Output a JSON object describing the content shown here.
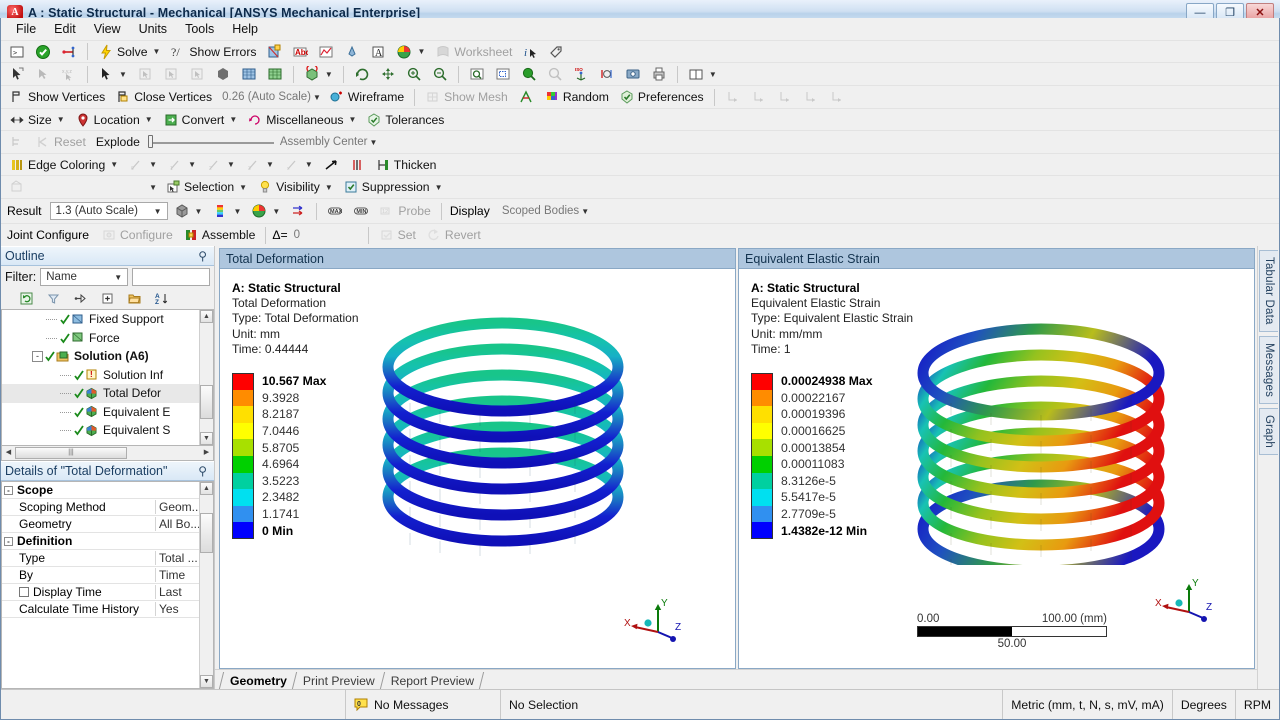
{
  "window": {
    "title": "A : Static Structural - Mechanical [ANSYS Mechanical Enterprise]",
    "app_icon": "ansys-logo-icon",
    "minimize_label": "—",
    "maximize_label": "❐",
    "close_label": "✕"
  },
  "menubar": {
    "items": [
      {
        "label": "File"
      },
      {
        "label": "Edit"
      },
      {
        "label": "View"
      },
      {
        "label": "Units"
      },
      {
        "label": "Tools"
      },
      {
        "label": "Help"
      }
    ]
  },
  "toolbar_main": {
    "solve_label": "Solve",
    "show_errors_label": "Show Errors",
    "worksheet_label": "Worksheet"
  },
  "toolbar_graphics": {
    "show_vertices_label": "Show Vertices",
    "close_vertices_label": "Close Vertices",
    "auto_scale_value": "0.26 (Auto Scale)",
    "wireframe_label": "Wireframe",
    "show_mesh_label": "Show Mesh",
    "random_label": "Random",
    "preferences_label": "Preferences"
  },
  "toolbar_edit": {
    "size_label": "Size",
    "location_label": "Location",
    "convert_label": "Convert",
    "miscellaneous_label": "Miscellaneous",
    "tolerances_label": "Tolerances"
  },
  "toolbar_explode": {
    "reset_label": "Reset",
    "explode_label": "Explode",
    "assembly_center_label": "Assembly Center"
  },
  "toolbar_edge": {
    "edge_coloring_label": "Edge Coloring",
    "thicken_label": "Thicken"
  },
  "toolbar_selection": {
    "selection_label": "Selection",
    "visibility_label": "Visibility",
    "suppression_label": "Suppression"
  },
  "toolbar_result": {
    "result_label": "Result",
    "result_scale_value": "1.3 (Auto Scale)",
    "probe_label": "Probe",
    "display_label": "Display",
    "display_value": "Scoped Bodies"
  },
  "toolbar_joint": {
    "joint_configure_label": "Joint Configure",
    "configure_label": "Configure",
    "assemble_label": "Assemble",
    "delta_label": "Δ=",
    "delta_value": "0",
    "set_label": "Set",
    "revert_label": "Revert"
  },
  "outline": {
    "panel_title": "Outline",
    "filter_label": "Filter:",
    "filter_value": "Name",
    "filter_text": "",
    "tree": [
      {
        "label": "Fixed Support",
        "indent": 3,
        "bold": false,
        "expander": "",
        "selected": false
      },
      {
        "label": "Force",
        "indent": 3,
        "bold": false,
        "expander": "",
        "selected": false
      },
      {
        "label": "Solution (A6)",
        "indent": 2,
        "bold": true,
        "expander": "-",
        "selected": false
      },
      {
        "label": "Solution Inf",
        "indent": 4,
        "bold": false,
        "expander": "",
        "selected": false
      },
      {
        "label": "Total Defor",
        "indent": 4,
        "bold": false,
        "expander": "",
        "selected": true
      },
      {
        "label": "Equivalent E",
        "indent": 4,
        "bold": false,
        "expander": "",
        "selected": false
      },
      {
        "label": "Equivalent S",
        "indent": 4,
        "bold": false,
        "expander": "",
        "selected": false
      }
    ]
  },
  "details": {
    "panel_title": "Details of \"Total Deformation\"",
    "rows": [
      {
        "kind": "header",
        "name": "Scope",
        "value": "",
        "expander": "-"
      },
      {
        "kind": "row",
        "name": "Scoping Method",
        "value": "Geom...",
        "checkbox": false
      },
      {
        "kind": "row",
        "name": "Geometry",
        "value": "All Bo...",
        "checkbox": false
      },
      {
        "kind": "header",
        "name": "Definition",
        "value": "",
        "expander": "-"
      },
      {
        "kind": "row",
        "name": "Type",
        "value": "Total ...",
        "checkbox": false
      },
      {
        "kind": "row",
        "name": "By",
        "value": "Time",
        "checkbox": false
      },
      {
        "kind": "row",
        "name": "Display Time",
        "value": "Last",
        "checkbox": true
      },
      {
        "kind": "row",
        "name": "Calculate Time History",
        "value": "Yes",
        "checkbox": false
      }
    ]
  },
  "viewport_left": {
    "title": "Total Deformation",
    "annotation": {
      "line1": "A: Static Structural",
      "line2": "Total Deformation",
      "line3": "Type: Total Deformation",
      "line4": "Unit: mm",
      "line5": "Time: 0.44444"
    },
    "legend": [
      {
        "label": "10.567 Max",
        "color": "#ff0000",
        "bold": true
      },
      {
        "label": "9.3928",
        "color": "#ff8c00",
        "bold": false
      },
      {
        "label": "8.2187",
        "color": "#ffe000",
        "bold": false
      },
      {
        "label": "7.0446",
        "color": "#ffff00",
        "bold": false
      },
      {
        "label": "5.8705",
        "color": "#a8e000",
        "bold": false
      },
      {
        "label": "4.6964",
        "color": "#00d000",
        "bold": false
      },
      {
        "label": "3.5223",
        "color": "#00d0a0",
        "bold": false
      },
      {
        "label": "2.3482",
        "color": "#00e0f0",
        "bold": false
      },
      {
        "label": "1.1741",
        "color": "#3090f0",
        "bold": false
      },
      {
        "label": "0 Min",
        "color": "#0000ff",
        "bold": true
      }
    ],
    "triad": {
      "x_label": "X",
      "y_label": "Y",
      "z_label": "Z"
    }
  },
  "viewport_right": {
    "title": "Equivalent Elastic Strain",
    "annotation": {
      "line1": "A: Static Structural",
      "line2": "Equivalent Elastic Strain",
      "line3": "Type: Equivalent Elastic Strain",
      "line4": "Unit: mm/mm",
      "line5": "Time: 1"
    },
    "legend": [
      {
        "label": "0.00024938 Max",
        "color": "#ff0000",
        "bold": true
      },
      {
        "label": "0.00022167",
        "color": "#ff8c00",
        "bold": false
      },
      {
        "label": "0.00019396",
        "color": "#ffe000",
        "bold": false
      },
      {
        "label": "0.00016625",
        "color": "#ffff00",
        "bold": false
      },
      {
        "label": "0.00013854",
        "color": "#a8e000",
        "bold": false
      },
      {
        "label": "0.00011083",
        "color": "#00d000",
        "bold": false
      },
      {
        "label": "8.3126e-5",
        "color": "#00d0a0",
        "bold": false
      },
      {
        "label": "5.5417e-5",
        "color": "#00e0f0",
        "bold": false
      },
      {
        "label": "2.7709e-5",
        "color": "#3090f0",
        "bold": false
      },
      {
        "label": "1.4382e-12 Min",
        "color": "#0000ff",
        "bold": true
      }
    ],
    "scalebar": {
      "min": "0.00",
      "max": "100.00 (mm)",
      "mid": "50.00"
    },
    "triad": {
      "x_label": "X",
      "y_label": "Y",
      "z_label": "Z"
    }
  },
  "bottom_tabs": [
    {
      "label": "Geometry",
      "active": true
    },
    {
      "label": "Print Preview",
      "active": false
    },
    {
      "label": "Report Preview",
      "active": false
    }
  ],
  "right_tabs": [
    {
      "label": "Tabular Data"
    },
    {
      "label": "Messages"
    },
    {
      "label": "Graph"
    }
  ],
  "statusbar": {
    "messages_count": "0",
    "messages_label": "No Messages",
    "selection_label": "No Selection",
    "units_label": "Metric (mm, t, N, s, mV, mA)",
    "angle_label": "Degrees",
    "rotation_label": "RPM"
  },
  "colors": {
    "titlebar_accent": "#b9d2ea",
    "viewport_header": "#aec6de",
    "selection_highlight": "#e8e8e8",
    "legend_max": "#ff0000",
    "legend_min": "#0000ff"
  }
}
